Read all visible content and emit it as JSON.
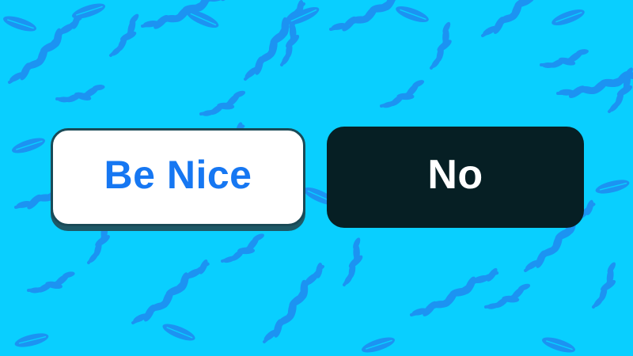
{
  "background": {
    "color": "#09CFFF",
    "pattern": "leafy-vine-pattern",
    "pattern_color": "#1C93F2"
  },
  "buttons": {
    "be_nice": {
      "label": "Be Nice",
      "background": "#FFFFFF",
      "text_color": "#1677F2",
      "border_color": "#1A4A57"
    },
    "no": {
      "label": "No",
      "background": "#061F24",
      "text_color": "#FFFFFF"
    }
  }
}
